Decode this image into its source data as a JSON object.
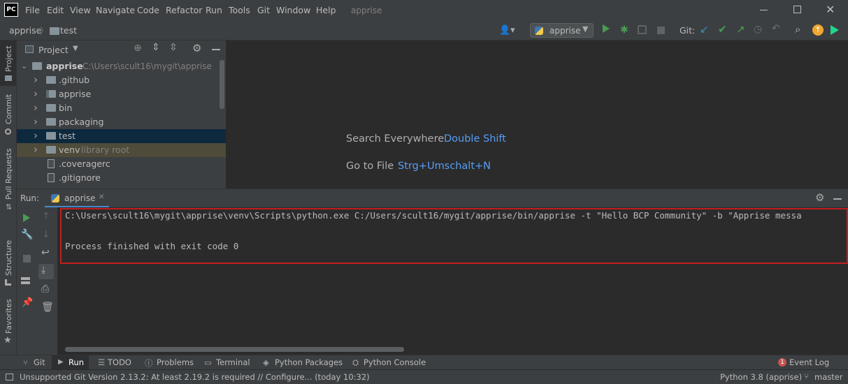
{
  "titlebar": {
    "logo": "PC",
    "menu": [
      "File",
      "Edit",
      "View",
      "Navigate",
      "Code",
      "Refactor",
      "Run",
      "Tools",
      "Git",
      "Window",
      "Help"
    ],
    "project_name": "apprise"
  },
  "navbar": {
    "breadcrumb_root": "apprise",
    "breadcrumb_child": "test",
    "run_config": "apprise",
    "git_label": "Git:"
  },
  "left_strip": {
    "project": "Project",
    "commit": "Commit",
    "pull_requests": "Pull Requests",
    "structure": "Structure",
    "favorites": "Favorites"
  },
  "project_panel": {
    "title": "Project",
    "root_name": "apprise",
    "root_path": "C:\\Users\\scult16\\mygit\\apprise",
    "items": [
      {
        "name": ".github",
        "kind": "folder"
      },
      {
        "name": "apprise",
        "kind": "package"
      },
      {
        "name": "bin",
        "kind": "folder"
      },
      {
        "name": "packaging",
        "kind": "folder"
      },
      {
        "name": "test",
        "kind": "folder"
      },
      {
        "name": "venv",
        "kind": "folder",
        "hint": "library root"
      },
      {
        "name": ".coveragerc",
        "kind": "file"
      },
      {
        "name": ".gitignore",
        "kind": "file"
      }
    ]
  },
  "editor": {
    "hint1_label": "Search Everywhere",
    "hint1_key": "Double Shift",
    "hint2_label": "Go to File",
    "hint2_key": "Strg+Umschalt+N"
  },
  "run_panel": {
    "label": "Run:",
    "tab": "apprise",
    "line1": "C:\\Users\\scult16\\mygit\\apprise\\venv\\Scripts\\python.exe C:/Users/scult16/mygit/apprise/bin/apprise -t \"Hello BCP Community\" -b \"Apprise messa",
    "line2": "Process finished with exit code 0"
  },
  "bottom_tabs": [
    "Git",
    "Run",
    "TODO",
    "Problems",
    "Terminal",
    "Python Packages",
    "Python Console"
  ],
  "event_log": {
    "label": "Event Log",
    "count": "1"
  },
  "status": {
    "message": "Unsupported Git Version 2.13.2: At least 2.19.2 is required // Configure... (today 10:32)",
    "interpreter": "Python 3.8 (apprise)",
    "branch": "master"
  },
  "colors": {
    "accent_link": "#589df6",
    "selection": "#0d293e",
    "highlight_box": "#c41e1e",
    "run_green": "#499c54"
  }
}
